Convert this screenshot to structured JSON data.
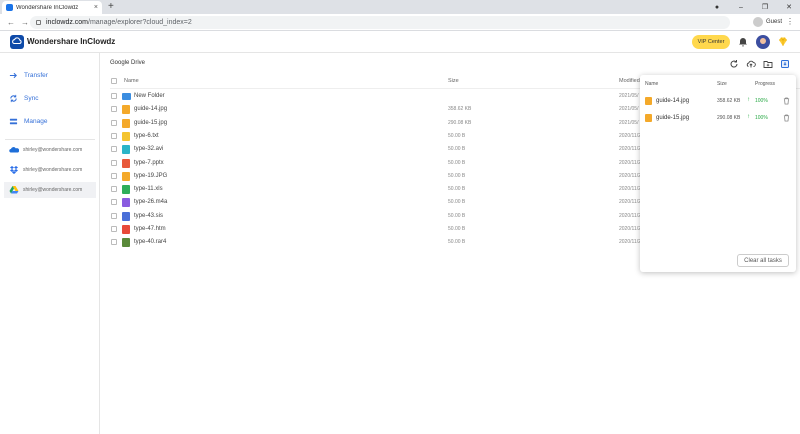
{
  "browser": {
    "tab_title": "Wondershare InClowdz",
    "tab_close": "×",
    "new_tab": "+",
    "url_domain": "inclowdz.com",
    "url_path": "/manage/explorer?cloud_index=2",
    "profile_label": "Guest",
    "win_min": "–",
    "win_max": "❐",
    "win_close": "✕",
    "back": "←",
    "forward": "→",
    "reload": "↻",
    "menu": "⋮",
    "record_icon": "●"
  },
  "app": {
    "brand": "Wondershare InClowdz",
    "vip_label": "VIP Center"
  },
  "sidebar": {
    "items": [
      {
        "label": "Transfer",
        "icon": "transfer-icon"
      },
      {
        "label": "Sync",
        "icon": "sync-icon"
      },
      {
        "label": "Manage",
        "icon": "manage-icon"
      }
    ],
    "accounts": [
      {
        "email": "shirley@wondershare.com",
        "icon": "onedrive-icon"
      },
      {
        "email": "shirley@wondershare.com",
        "icon": "dropbox-icon"
      },
      {
        "email": "shirley@wondershare.com",
        "icon": "google-drive-icon"
      }
    ]
  },
  "main": {
    "breadcrumb": "Google Drive",
    "columns": {
      "name": "Name",
      "size": "Size",
      "modified": "Modified"
    },
    "files": [
      {
        "name": "New Folder",
        "size": "",
        "date": "2021/05/",
        "type": "folder",
        "color": "#3b8de0"
      },
      {
        "name": "guide-14.jpg",
        "size": "358.62 KB",
        "date": "2021/05/",
        "type": "image",
        "color": "#f4a92a"
      },
      {
        "name": "guide-15.jpg",
        "size": "290.08 KB",
        "date": "2021/05/",
        "type": "image",
        "color": "#f4a92a"
      },
      {
        "name": "type-6.txt",
        "size": "50.00 B",
        "date": "2020/11/2",
        "type": "text",
        "color": "#f4c430"
      },
      {
        "name": "type-32.avi",
        "size": "50.00 B",
        "date": "2020/11/2",
        "type": "video",
        "color": "#2bb5c8"
      },
      {
        "name": "type-7.pptx",
        "size": "50.00 B",
        "date": "2020/11/2",
        "type": "ppt",
        "color": "#e8583a"
      },
      {
        "name": "type-19.JPG",
        "size": "50.00 B",
        "date": "2020/11/2",
        "type": "image",
        "color": "#f4a92a"
      },
      {
        "name": "type-11.xls",
        "size": "50.00 B",
        "date": "2020/11/2",
        "type": "excel",
        "color": "#2fae5a"
      },
      {
        "name": "type-26.m4a",
        "size": "50.00 B",
        "date": "2020/11/2",
        "type": "audio",
        "color": "#8a5be0"
      },
      {
        "name": "type-43.sis",
        "size": "50.00 B",
        "date": "2020/11/2",
        "type": "other",
        "color": "#4a6fd8"
      },
      {
        "name": "type-47.htm",
        "size": "50.00 B",
        "date": "2020/11/2",
        "type": "web",
        "color": "#e84a3a"
      },
      {
        "name": "type-40.rar4",
        "size": "50.00 B",
        "date": "2020/11/2",
        "type": "archive",
        "color": "#5a8a3a"
      }
    ]
  },
  "panel": {
    "headers": {
      "name": "Name",
      "size": "Size",
      "progress": "Progress"
    },
    "tasks": [
      {
        "name": "guide-14.jpg",
        "size": "358.62 KB",
        "arrow": "↑",
        "progress": "100%"
      },
      {
        "name": "guide-15.jpg",
        "size": "290.08 KB",
        "arrow": "↑",
        "progress": "100%"
      }
    ],
    "clear_label": "Clear all tasks"
  }
}
